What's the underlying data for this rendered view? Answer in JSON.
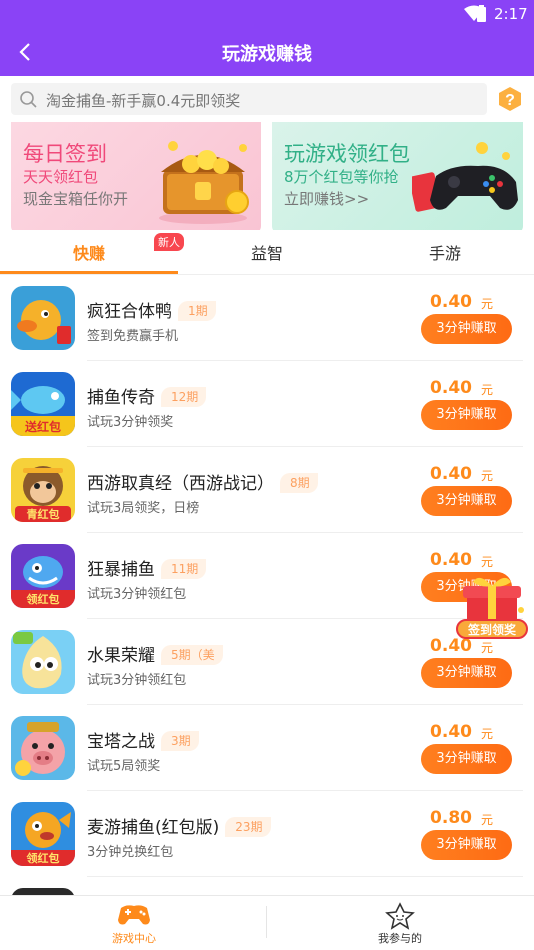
{
  "status": {
    "time": "2:17"
  },
  "header": {
    "title": "玩游戏赚钱"
  },
  "search": {
    "placeholder": "淘金捕鱼-新手赢0.4元即领奖"
  },
  "banners": [
    {
      "title": "每日签到",
      "line1": "天天领红包",
      "line2": "现金宝箱任你开"
    },
    {
      "title": "玩游戏领红包",
      "line1": "8万个红包等你抢",
      "line2": "立即赚钱>>"
    }
  ],
  "tabs": [
    {
      "label": "快赚",
      "active": true
    },
    {
      "label": "益智",
      "active": false
    },
    {
      "label": "手游",
      "active": false
    }
  ],
  "new_badge": "新人",
  "games": [
    {
      "name": "疯狂合体鸭",
      "period": "1期",
      "desc": "签到免费赢手机",
      "price": "0.40",
      "unit": "元",
      "button": "3分钟赚取"
    },
    {
      "name": "捕鱼传奇",
      "period": "12期",
      "desc": "试玩3分钟领奖",
      "price": "0.40",
      "unit": "元",
      "button": "3分钟赚取"
    },
    {
      "name": "西游取真经（西游战记）",
      "period": "8期",
      "desc": "试玩3局领奖，日榜",
      "price": "0.40",
      "unit": "元",
      "button": "3分钟赚取"
    },
    {
      "name": "狂暴捕鱼",
      "period": "11期",
      "desc": "试玩3分钟领红包",
      "price": "0.40",
      "unit": "元",
      "button": "3分钟赚取"
    },
    {
      "name": "水果荣耀",
      "period": "5期（美",
      "desc": "试玩3分钟领红包",
      "price": "0.40",
      "unit": "元",
      "button": "3分钟赚取"
    },
    {
      "name": "宝塔之战",
      "period": "3期",
      "desc": "试玩5局领奖",
      "price": "0.40",
      "unit": "元",
      "button": "3分钟赚取"
    },
    {
      "name": "麦游捕鱼(红包版)",
      "period": "23期",
      "desc": "3分钟兑换红包",
      "price": "0.80",
      "unit": "元",
      "button": "3分钟赚取"
    }
  ],
  "icon_badges": {
    "fish1": "送红包",
    "monkey": "青红包",
    "fish2": "领红包",
    "fish3": "领红包"
  },
  "float_gift": {
    "label": "签到领奖"
  },
  "bottom_nav": [
    {
      "label": "游戏中心",
      "active": true
    },
    {
      "label": "我参与的",
      "active": false
    }
  ],
  "colors": {
    "brand": "#8a43f6",
    "accent": "#fe8a1b",
    "red": "#f8474f"
  }
}
